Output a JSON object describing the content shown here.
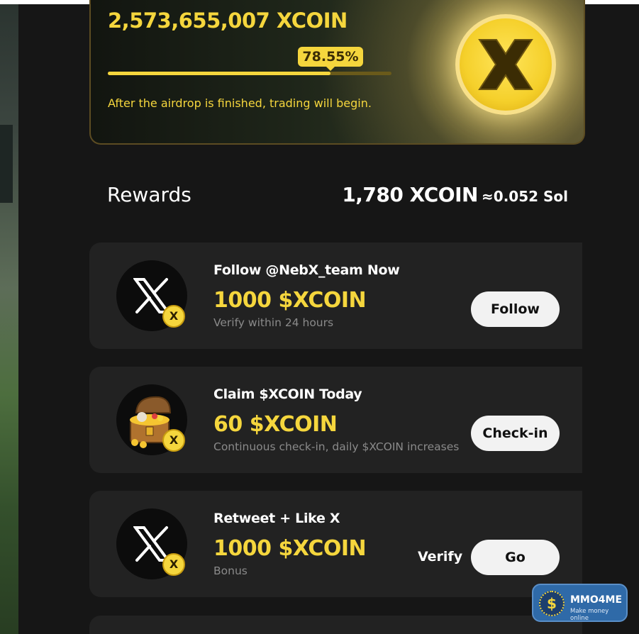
{
  "hero": {
    "amount": "2,573,655,007 XCOIN",
    "progress_label": "78.55%",
    "progress_value": 78.55,
    "note": "After the airdrop is finished, trading will begin."
  },
  "rewards": {
    "title": "Rewards",
    "balance_amount": "1,780 XCOIN",
    "balance_sol": "≈0.052 Sol"
  },
  "tasks": [
    {
      "title": "Follow @NebX_team Now",
      "reward": "1000 $XCOIN",
      "subtitle": "Verify within 24 hours",
      "button": "Follow",
      "icon": "x-logo-icon"
    },
    {
      "title": "Claim $XCOIN Today",
      "reward": "60 $XCOIN",
      "subtitle": "Continuous check-in, daily $XCOIN increases",
      "button": "Check-in",
      "icon": "treasure-chest-icon"
    },
    {
      "title": "Retweet + Like X",
      "reward": "1000 $XCOIN",
      "subtitle": "Bonus",
      "verify": "Verify",
      "button": "Go",
      "icon": "x-logo-icon"
    }
  ],
  "coin_badge": "X",
  "watermark": {
    "name": "MMO4ME",
    "tagline": "Make money online",
    "logo": "$"
  },
  "colors": {
    "accent": "#f5d63d",
    "card_bg": "#222222",
    "panel_bg": "#161616"
  }
}
